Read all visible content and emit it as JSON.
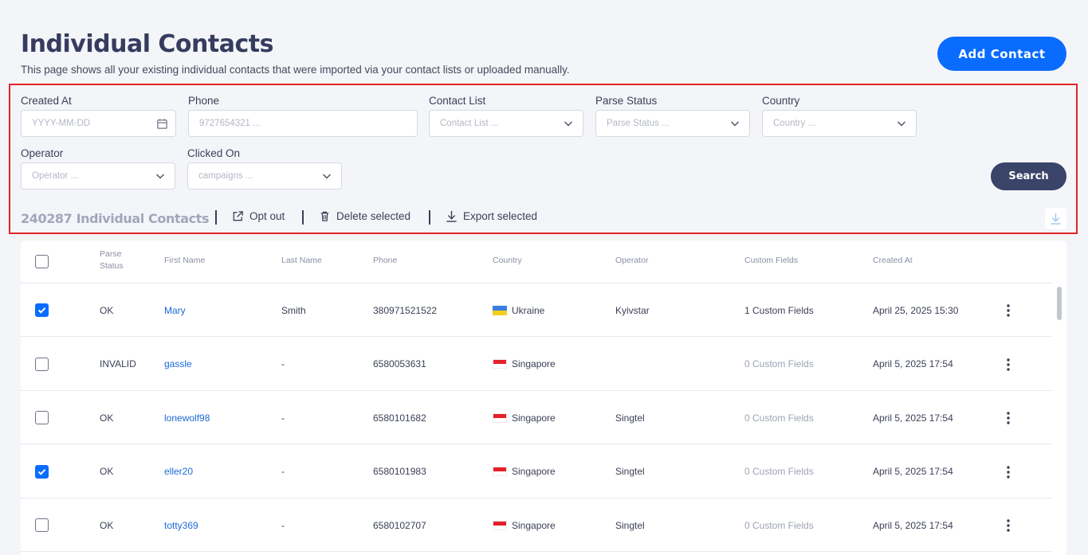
{
  "header": {
    "title": "Individual Contacts",
    "description": "This page shows all your existing individual contacts that were imported via your contact lists or uploaded manually.",
    "add_button": "Add Contact"
  },
  "filters": {
    "created_at": {
      "label": "Created At",
      "placeholder": "YYYY-MM-DD"
    },
    "phone": {
      "label": "Phone",
      "placeholder": "9727654321 ..."
    },
    "contact_list": {
      "label": "Contact List",
      "placeholder": "Contact List ..."
    },
    "parse_status": {
      "label": "Parse Status",
      "placeholder": "Parse Status ..."
    },
    "country": {
      "label": "Country",
      "placeholder": "Country ..."
    },
    "operator": {
      "label": "Operator",
      "placeholder": "Operator ..."
    },
    "clicked_on": {
      "label": "Clicked On",
      "placeholder": "campaigns ..."
    },
    "search_button": "Search"
  },
  "actions": {
    "count": "240287 Individual Contacts",
    "opt_out": "Opt out",
    "delete_selected": "Delete selected",
    "export_selected": "Export selected"
  },
  "table": {
    "columns": {
      "parse_status": "Parse Status",
      "first_name": "First Name",
      "last_name": "Last Name",
      "phone": "Phone",
      "country": "Country",
      "operator": "Operator",
      "custom_fields": "Custom Fields",
      "created_at": "Created At"
    },
    "rows": [
      {
        "checked": true,
        "status": "OK",
        "first": "Mary",
        "last": "Smith",
        "phone": "380971521522",
        "flag": "ua",
        "country": "Ukraine",
        "operator": "Kyivstar",
        "custom": "1 Custom Fields",
        "custom_muted": false,
        "created": "April 25, 2025 15:30"
      },
      {
        "checked": false,
        "status": "INVALID",
        "first": "gassle",
        "last": "-",
        "phone": "6580053631",
        "flag": "sg",
        "country": "Singapore",
        "operator": "",
        "custom": "0 Custom Fields",
        "custom_muted": true,
        "created": "April 5, 2025 17:54"
      },
      {
        "checked": false,
        "status": "OK",
        "first": "lonewolf98",
        "last": "-",
        "phone": "6580101682",
        "flag": "sg",
        "country": "Singapore",
        "operator": "Singtel",
        "custom": "0 Custom Fields",
        "custom_muted": true,
        "created": "April 5, 2025 17:54"
      },
      {
        "checked": true,
        "status": "OK",
        "first": "eller20",
        "last": "-",
        "phone": "6580101983",
        "flag": "sg",
        "country": "Singapore",
        "operator": "Singtel",
        "custom": "0 Custom Fields",
        "custom_muted": true,
        "created": "April 5, 2025 17:54"
      },
      {
        "checked": false,
        "status": "OK",
        "first": "totty369",
        "last": "-",
        "phone": "6580102707",
        "flag": "sg",
        "country": "Singapore",
        "operator": "Singtel",
        "custom": "0 Custom Fields",
        "custom_muted": true,
        "created": "April 5, 2025 17:54"
      }
    ]
  }
}
